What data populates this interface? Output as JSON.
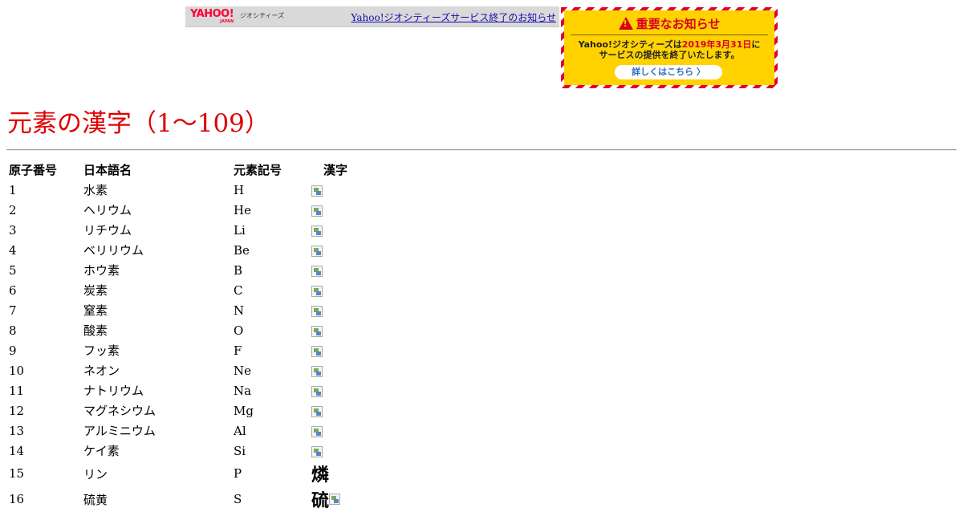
{
  "banner": {
    "logo_text": "YAHOO!",
    "logo_sub": "JAPAN",
    "service_label": "ジオシティーズ",
    "link_text": "Yahoo!ジオシティーズサービス終了のお知らせ"
  },
  "notice": {
    "title": "重要なお知らせ",
    "body_line1_prefix": "Yahoo!ジオシティーズは",
    "body_line1_date": "2019年3月31日",
    "body_line1_suffix": "に",
    "body_line2": "サービスの提供を終了いたします。",
    "button_label": "詳しくはこちら 〉",
    "colors": {
      "stripe": "#e0002a",
      "background": "#ffd200",
      "title": "#d8001e",
      "button_text": "#2d6fc2"
    }
  },
  "page": {
    "title": "元素の漢字（1～109）",
    "title_color": "#e00000"
  },
  "table": {
    "headers": [
      "原子番号",
      "日本語名",
      "元素記号",
      "漢字"
    ],
    "rows": [
      {
        "num": "1",
        "name": "水素",
        "symbol": "H",
        "kanji_text": "",
        "kanji_img": true
      },
      {
        "num": "2",
        "name": "ヘリウム",
        "symbol": "He",
        "kanji_text": "",
        "kanji_img": true
      },
      {
        "num": "3",
        "name": "リチウム",
        "symbol": "Li",
        "kanji_text": "",
        "kanji_img": true
      },
      {
        "num": "4",
        "name": "ベリリウム",
        "symbol": "Be",
        "kanji_text": "",
        "kanji_img": true
      },
      {
        "num": "5",
        "name": "ホウ素",
        "symbol": "B",
        "kanji_text": "",
        "kanji_img": true
      },
      {
        "num": "6",
        "name": "炭素",
        "symbol": "C",
        "kanji_text": "",
        "kanji_img": true
      },
      {
        "num": "7",
        "name": "窒素",
        "symbol": "N",
        "kanji_text": "",
        "kanji_img": true
      },
      {
        "num": "8",
        "name": "酸素",
        "symbol": "O",
        "kanji_text": "",
        "kanji_img": true
      },
      {
        "num": "9",
        "name": "フッ素",
        "symbol": "F",
        "kanji_text": "",
        "kanji_img": true
      },
      {
        "num": "10",
        "name": "ネオン",
        "symbol": "Ne",
        "kanji_text": "",
        "kanji_img": true
      },
      {
        "num": "11",
        "name": "ナトリウム",
        "symbol": "Na",
        "kanji_text": "",
        "kanji_img": true
      },
      {
        "num": "12",
        "name": "マグネシウム",
        "symbol": "Mg",
        "kanji_text": "",
        "kanji_img": true
      },
      {
        "num": "13",
        "name": "アルミニウム",
        "symbol": "Al",
        "kanji_text": "",
        "kanji_img": true
      },
      {
        "num": "14",
        "name": "ケイ素",
        "symbol": "Si",
        "kanji_text": "",
        "kanji_img": true
      },
      {
        "num": "15",
        "name": "リン",
        "symbol": "P",
        "kanji_text": "燐",
        "kanji_img": false
      },
      {
        "num": "16",
        "name": "硫黄",
        "symbol": "S",
        "kanji_text": "硫",
        "kanji_img": true
      }
    ]
  },
  "icons": {
    "warning": "warning-icon",
    "broken_image": "broken-image-icon"
  }
}
